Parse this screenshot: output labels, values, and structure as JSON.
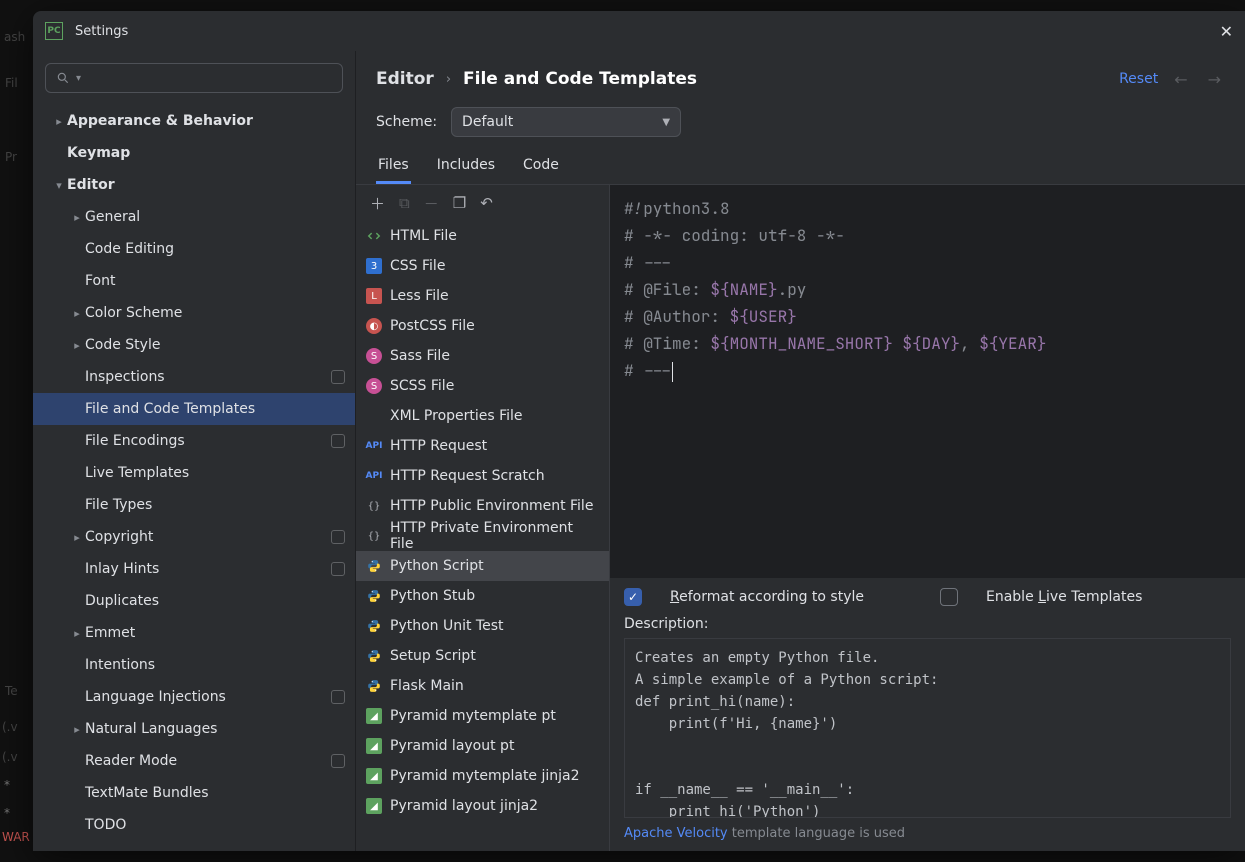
{
  "window_title": "Settings",
  "breadcrumb": {
    "root": "Editor",
    "leaf": "File and Code Templates"
  },
  "reset_label": "Reset",
  "scheme": {
    "label": "Scheme:",
    "value": "Default"
  },
  "tabs": {
    "files": "Files",
    "includes": "Includes",
    "code": "Code",
    "active": "files"
  },
  "sidebar": [
    {
      "label": "Appearance & Behavior",
      "depth": 0,
      "expandable": true,
      "expanded": false,
      "bold": true
    },
    {
      "label": "Keymap",
      "depth": 0,
      "bold": true
    },
    {
      "label": "Editor",
      "depth": 0,
      "expandable": true,
      "expanded": true,
      "bold": true
    },
    {
      "label": "General",
      "depth": 1,
      "expandable": true
    },
    {
      "label": "Code Editing",
      "depth": 1
    },
    {
      "label": "Font",
      "depth": 1
    },
    {
      "label": "Color Scheme",
      "depth": 1,
      "expandable": true
    },
    {
      "label": "Code Style",
      "depth": 1,
      "expandable": true
    },
    {
      "label": "Inspections",
      "depth": 1,
      "badge": true
    },
    {
      "label": "File and Code Templates",
      "depth": 1,
      "selected": true
    },
    {
      "label": "File Encodings",
      "depth": 1,
      "badge": true
    },
    {
      "label": "Live Templates",
      "depth": 1
    },
    {
      "label": "File Types",
      "depth": 1
    },
    {
      "label": "Copyright",
      "depth": 1,
      "expandable": true,
      "badge": true
    },
    {
      "label": "Inlay Hints",
      "depth": 1,
      "badge": true
    },
    {
      "label": "Duplicates",
      "depth": 1
    },
    {
      "label": "Emmet",
      "depth": 1,
      "expandable": true
    },
    {
      "label": "Intentions",
      "depth": 1
    },
    {
      "label": "Language Injections",
      "depth": 1,
      "badge": true
    },
    {
      "label": "Natural Languages",
      "depth": 1,
      "expandable": true
    },
    {
      "label": "Reader Mode",
      "depth": 1,
      "badge": true
    },
    {
      "label": "TextMate Bundles",
      "depth": 1
    },
    {
      "label": "TODO",
      "depth": 1
    }
  ],
  "templates": [
    {
      "label": "HTML File",
      "icon": "html"
    },
    {
      "label": "CSS File",
      "icon": "css"
    },
    {
      "label": "Less File",
      "icon": "less"
    },
    {
      "label": "PostCSS File",
      "icon": "postcss"
    },
    {
      "label": "Sass File",
      "icon": "sass"
    },
    {
      "label": "SCSS File",
      "icon": "sass"
    },
    {
      "label": "XML Properties File",
      "icon": "xml"
    },
    {
      "label": "HTTP Request",
      "icon": "api"
    },
    {
      "label": "HTTP Request Scratch",
      "icon": "api"
    },
    {
      "label": "HTTP Public Environment File",
      "icon": "json"
    },
    {
      "label": "HTTP Private Environment File",
      "icon": "json"
    },
    {
      "label": "Python Script",
      "icon": "py",
      "selected": true
    },
    {
      "label": "Python Stub",
      "icon": "py"
    },
    {
      "label": "Python Unit Test",
      "icon": "py"
    },
    {
      "label": "Setup Script",
      "icon": "py"
    },
    {
      "label": "Flask Main",
      "icon": "py"
    },
    {
      "label": "Pyramid mytemplate pt",
      "icon": "pyr"
    },
    {
      "label": "Pyramid layout pt",
      "icon": "pyr"
    },
    {
      "label": "Pyramid mytemplate jinja2",
      "icon": "pyr"
    },
    {
      "label": "Pyramid layout jinja2",
      "icon": "pyr"
    }
  ],
  "code": {
    "l1": "#!python3.8",
    "l2": "# -*- coding: utf-8 -*-",
    "l3": "# ---",
    "l4a": "# @File: ",
    "l4v": "${NAME}",
    "l4b": ".py",
    "l5a": "# @Author: ",
    "l5v": "${USER}",
    "l6a": "# @Time: ",
    "l6v1": "${MONTH_NAME_SHORT}",
    "l6s": " ",
    "l6v2": "${DAY}",
    "l6c": ", ",
    "l6v3": "${YEAR}",
    "l7": "# ---"
  },
  "options": {
    "reformat_pre": "R",
    "reformat": "eformat according to style",
    "reformat_checked": true,
    "live_pre": "Enable ",
    "live_mne": "L",
    "live_post": "ive Templates",
    "live_checked": false
  },
  "description": {
    "label": "Description:",
    "text": "Creates an empty Python file.\nA simple example of a Python script:\ndef print_hi(name):\n    print(f'Hi, {name}')\n\n\nif __name__ == '__main__':\n    print_hi('Python')"
  },
  "footer": {
    "link": "Apache Velocity",
    "tail": " template language is used"
  }
}
